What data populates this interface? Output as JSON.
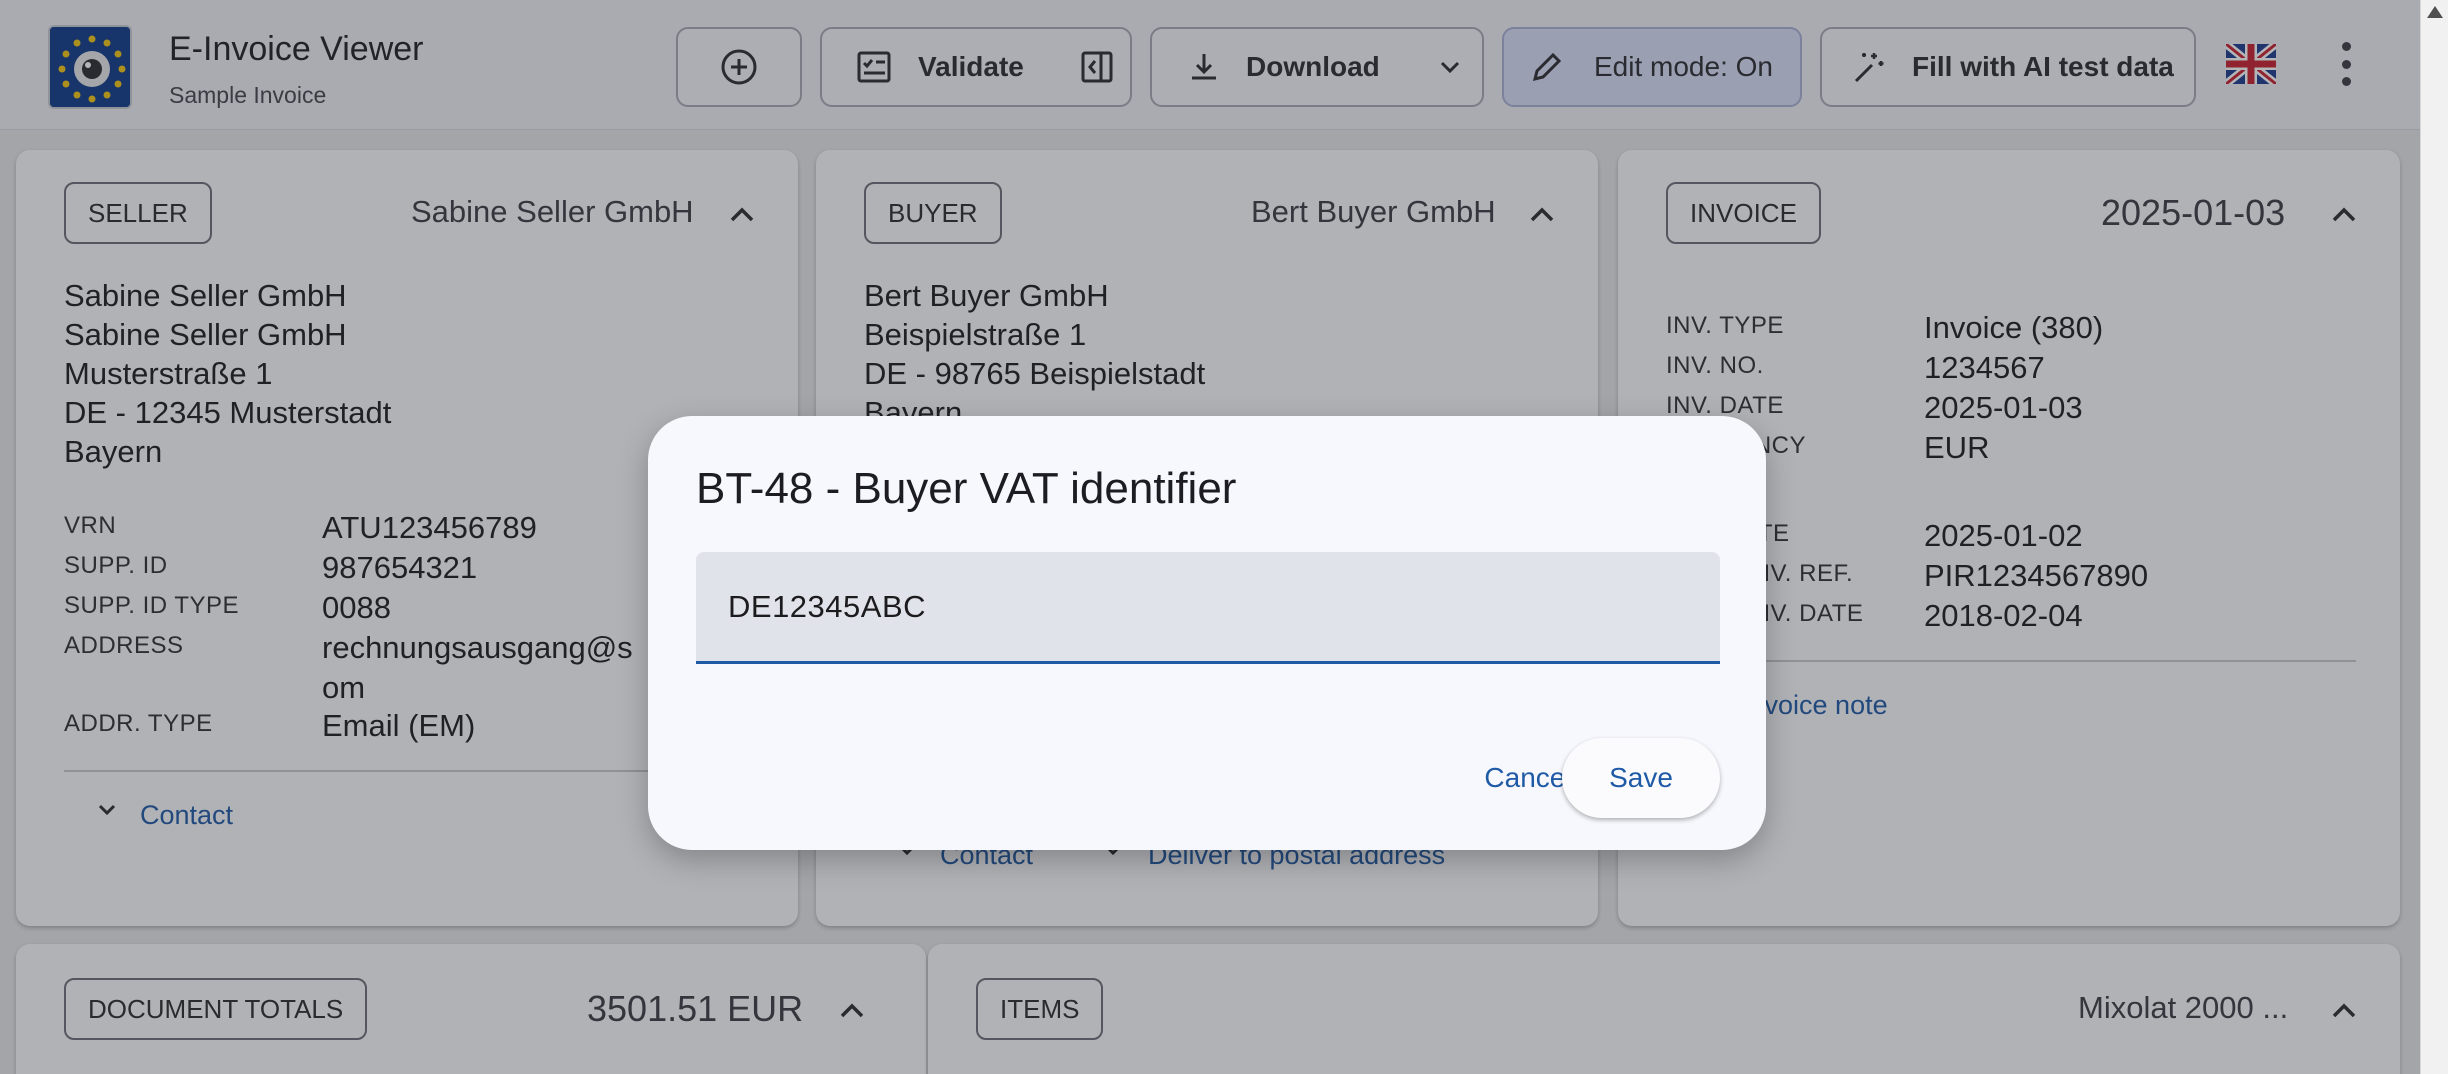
{
  "app": {
    "title": "E-Invoice Viewer",
    "subtitle": "Sample Invoice"
  },
  "toolbar": {
    "add_icon": "plus-circle-icon",
    "validate_label": "Validate",
    "download_label": "Download",
    "edit_mode_label": "Edit mode: On",
    "fill_ai_label": "Fill with AI test data",
    "language_flag": "uk-flag"
  },
  "seller": {
    "chip": "SELLER",
    "header_name": "Sabine Seller GmbH",
    "address_lines": "Sabine Seller GmbH\nSabine Seller GmbH\nMusterstraße 1\nDE - 12345 Musterstadt\nBayern",
    "fields": [
      {
        "key": "VRN",
        "value": "ATU123456789"
      },
      {
        "key": "SUPP. ID",
        "value": "987654321"
      },
      {
        "key": "SUPP. ID TYPE",
        "value": "0088"
      },
      {
        "key": "ADDRESS",
        "value": "rechnungsausgang@s"
      },
      {
        "key": "ADDR. TYPE",
        "value": "Email (EM)"
      }
    ],
    "address_wrap": "om",
    "contact_link": "Contact"
  },
  "buyer": {
    "chip": "BUYER",
    "header_name": "Bert Buyer GmbH",
    "address_lines": "Bert Buyer GmbH\nBeispielstraße 1\nDE - 98765 Beispielstadt\nBayern",
    "contact_link": "Contact",
    "deliver_link": "Deliver to postal address"
  },
  "invoice": {
    "chip": "INVOICE",
    "header_date": "2025-01-03",
    "fields": [
      {
        "key": "INV. TYPE",
        "value": "Invoice (380)"
      },
      {
        "key": "INV. NO.",
        "value": "1234567"
      },
      {
        "key": "INV. DATE",
        "value": "2025-01-03"
      },
      {
        "key": "CURRENCY",
        "value": "EUR"
      },
      {
        "key": "DUE DATE",
        "value": "2025-01-02"
      },
      {
        "key": "PREV. INV. REF.",
        "value": "PIR1234567890"
      },
      {
        "key": "PREV. INV. DATE",
        "value": "2018-02-04"
      }
    ],
    "note_link": "Invoice note"
  },
  "totals": {
    "chip": "DOCUMENT TOTALS",
    "amount": "3501.51 EUR"
  },
  "items": {
    "chip": "ITEMS",
    "summary": "Mixolat 2000 ..."
  },
  "dialog": {
    "title": "BT-48 - Buyer VAT identifier",
    "value": "DE12345ABC",
    "cancel_label": "Cancel",
    "save_label": "Save"
  },
  "colors": {
    "accent": "#1f5aa6",
    "edit_mode_bg": "#d9def7"
  }
}
